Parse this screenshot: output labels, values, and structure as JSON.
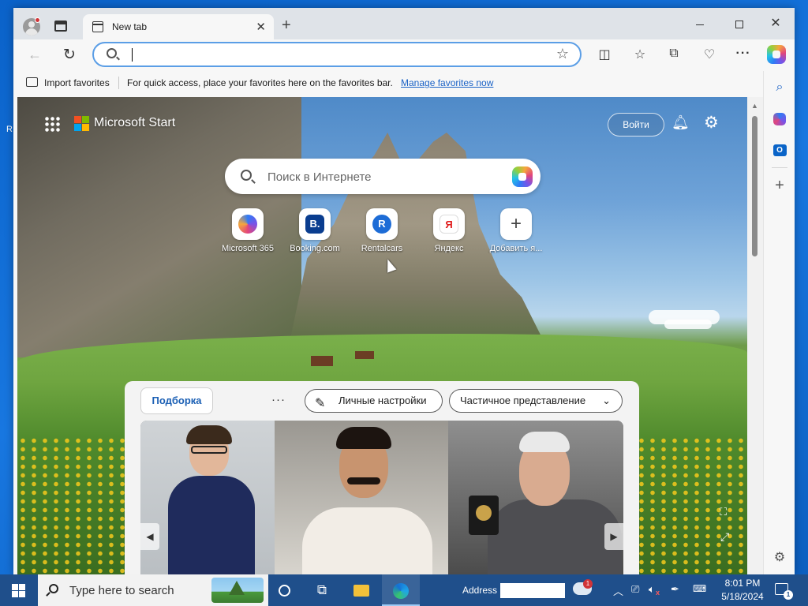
{
  "desktop": {
    "edge_glyph": "R"
  },
  "browser": {
    "tab": {
      "title": "New tab",
      "close": "✕"
    },
    "new_tab": "+",
    "window_controls": {
      "minimize": "",
      "maximize": "",
      "close": "✕"
    },
    "toolbar": {
      "back": "←",
      "reload": "↻",
      "address_value": "",
      "favorite_star": "☆",
      "split_screen": "◫",
      "favorites": "☆",
      "collections": "⧉",
      "performance": "♡",
      "more": "···"
    },
    "favorites_bar": {
      "import_label": "Import favorites",
      "hint": "For quick access, place your favorites here on the favorites bar.",
      "manage_link": "Manage favorites now"
    },
    "sidebar": {
      "search": "⌕",
      "outlook": "O",
      "add": "+",
      "settings": "⚙"
    }
  },
  "page": {
    "brand": "Microsoft Start",
    "signin": "Войти",
    "bell": "🔔︎",
    "gear": "⚙",
    "search_placeholder": "Поиск в Интернете",
    "quick_links": [
      {
        "label": "Microsoft 365",
        "glyph": ""
      },
      {
        "label": "Booking.com",
        "glyph": "B."
      },
      {
        "label": "Rentalcars",
        "glyph": "R"
      },
      {
        "label": "Яндекс",
        "glyph": "Я"
      },
      {
        "label": "Добавить я...",
        "glyph": "+"
      }
    ],
    "feed": {
      "tab_label": "Подборка",
      "more": "···",
      "personal_label": "Личные настройки",
      "personal_icon": "✎",
      "view_label": "Частичное представление",
      "view_chevron": "⌄",
      "arrow_left": "◀",
      "arrow_right": "▶"
    },
    "bg_photo_icon": "⛶",
    "bg_expand_icon": "⤢",
    "scroll_up": "▲"
  },
  "taskbar": {
    "search_placeholder": "Type here to search",
    "task_view": "⧉",
    "address_label": "Address",
    "address_value": "",
    "weather_badge": "1",
    "tray_up": "︿",
    "tray_network": "⎚",
    "tray_volume": "🔈︎",
    "tray_volume_x": "x",
    "tray_pen": "✒",
    "tray_keyboard": "⌨",
    "time": "8:01 PM",
    "date": "5/18/2024",
    "notification_badge": "1"
  }
}
